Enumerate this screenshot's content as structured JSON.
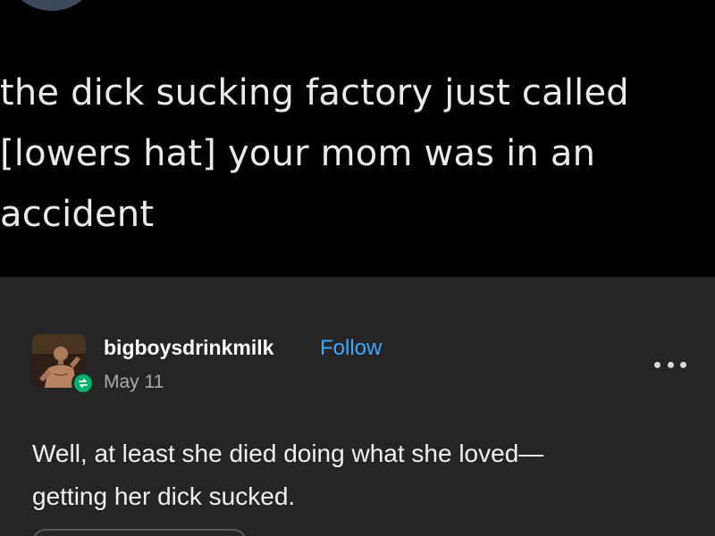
{
  "tweet": {
    "lines": [
      "the dick sucking factory just called",
      "[lowers hat] your mom was in an",
      "accident"
    ]
  },
  "post": {
    "username": "bigboysdrinkmilk",
    "follow_label": "Follow",
    "date": "May 11",
    "body_lines": [
      "Well, at least she died doing what she loved—",
      "getting her dick sucked."
    ],
    "avatar_icon": "user-avatar-photo",
    "badge_icon": "reblog-icon",
    "menu_icon": "more-options-icon"
  },
  "colors": {
    "tweet_bg": "#000000",
    "post_bg": "#252525",
    "follow_link": "#3ea6ff",
    "reblog_badge": "#00b26a"
  }
}
